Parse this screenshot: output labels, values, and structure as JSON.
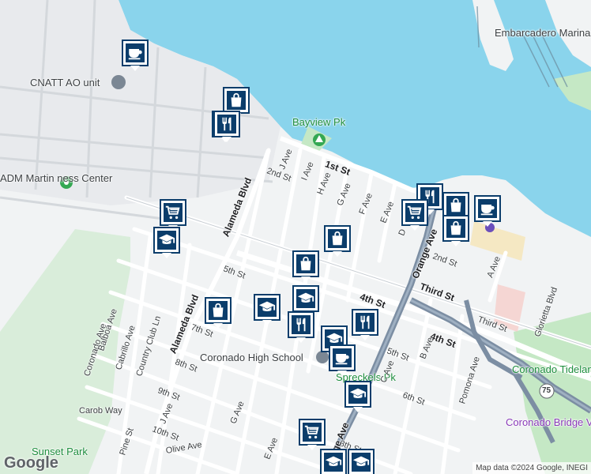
{
  "map": {
    "attribution": "Map data ©2024 Google, INEGI",
    "logo": "Google",
    "colors": {
      "water": "#8ad4ec",
      "land": "#f1f3f4",
      "park": "#c5e8c5",
      "freeway": "#7c8ea3",
      "marker_border": "#0b3d6b"
    }
  },
  "places": {
    "embarcadero": "Embarcadero Marina Pk North",
    "cnatt": "CNATT AO unit",
    "bayview": "Bayview Pk",
    "fitness": "ADM Martin ness Center",
    "coronado_high": "Coronado High School",
    "tidelands": "Coronado Tidelands Pk",
    "bridge_viewpoint": "Coronado Bridge Viewpoint",
    "sunset_park": "Sunset Park",
    "spreckels": "Spreckels Pk"
  },
  "streets": {
    "first_st": "1st St",
    "second_st": "2nd St",
    "second_st_e": "2nd St",
    "fourth_st": "4th St",
    "fourth_st_e": "4th St",
    "third_st": "Third St",
    "third_st_e": "Third St",
    "fifth_st": "5th St",
    "fifth_st_e": "5th St",
    "sixth_st": "6th St",
    "seventh_st": "7th St",
    "eighth_st": "8th St",
    "eighth_st_s": "8th St",
    "ninth_st": "9th St",
    "tenth_st": "10th St",
    "alameda_n": "Alameda Blvd",
    "alameda_s": "Alameda Blvd",
    "orange_n": "Orange Ave",
    "orange_s": "Orange Ave",
    "j_ave": "J Ave",
    "j_ave_s": "J Ave",
    "i_ave": "I Ave",
    "h_ave": "H Ave",
    "g_ave": "G Ave",
    "g_ave_s": "G Ave",
    "f_ave": "F Ave",
    "e_ave": "E Ave",
    "e_ave_s": "E Ave",
    "d_ave": "D",
    "c_ave": "C Ave",
    "b_ave": "B Ave",
    "a_ave": "A Ave",
    "coronado_ave": "Coronado Ave",
    "balboa_ave": "Balboa Ave",
    "cabrillo_ave": "Cabrillo Ave",
    "country_club": "Country Club Ln",
    "carob_way": "Carob Way",
    "pine_st": "Pine St",
    "olive_ave": "Olive Ave",
    "pomona_ave": "Pomona Ave",
    "glorietta": "Glorietta Blvd",
    "route_75": "75"
  },
  "markers": [
    {
      "type": "cafe"
    },
    {
      "type": "shopping"
    },
    {
      "type": "restaurant"
    },
    {
      "type": "restaurant"
    },
    {
      "type": "grocery"
    },
    {
      "type": "school"
    },
    {
      "type": "shopping"
    },
    {
      "type": "shopping"
    },
    {
      "type": "school"
    },
    {
      "type": "shopping"
    },
    {
      "type": "school"
    },
    {
      "type": "restaurant"
    },
    {
      "type": "restaurant"
    },
    {
      "type": "school"
    },
    {
      "type": "cafe"
    },
    {
      "type": "school"
    },
    {
      "type": "grocery"
    },
    {
      "type": "school"
    },
    {
      "type": "school"
    },
    {
      "type": "restaurant"
    },
    {
      "type": "grocery"
    },
    {
      "type": "shopping"
    },
    {
      "type": "shopping"
    },
    {
      "type": "cafe"
    }
  ]
}
